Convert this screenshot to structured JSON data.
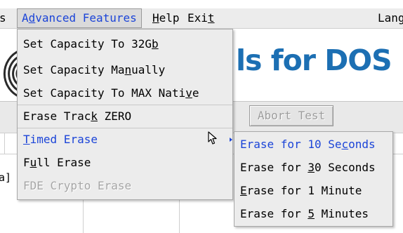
{
  "menubar": {
    "items": [
      {
        "label": "s",
        "mnemonic": ""
      },
      {
        "label": "Advanced Features",
        "pre": "A",
        "mn": "d",
        "post": "vanced Features"
      },
      {
        "label": "Help",
        "pre": "",
        "mn": "H",
        "post": "elp"
      },
      {
        "label": "Exit",
        "pre": "Exi",
        "mn": "t",
        "post": ""
      },
      {
        "label": "Lang"
      }
    ]
  },
  "brand": {
    "title": "ls for DOS"
  },
  "toolbar": {
    "abort_label": "Abort Test"
  },
  "panel": {
    "left_text": "a]"
  },
  "dropdown": {
    "items": [
      {
        "pre": "Set Capacity To 32G",
        "mn": "b",
        "post": "",
        "state": "normal"
      },
      {
        "pre": "Set Capacity Ma",
        "mn": "n",
        "post": "ually",
        "state": "normal"
      },
      {
        "pre": "Set Capacity To MAX Nati",
        "mn": "v",
        "post": "e",
        "state": "normal"
      },
      {
        "pre": "Erase Trac",
        "mn": "k",
        "post": " ZERO",
        "state": "normal"
      },
      {
        "pre": "",
        "mn": "T",
        "post": "imed Erase",
        "state": "active"
      },
      {
        "pre": "F",
        "mn": "u",
        "post": "ll Erase",
        "state": "normal"
      },
      {
        "pre": "FDE Crypto Erase",
        "mn": "",
        "post": "",
        "state": "disabled"
      }
    ]
  },
  "submenu": {
    "items": [
      {
        "pre": "Erase for 10 Se",
        "mn": "c",
        "post": "onds",
        "state": "active"
      },
      {
        "pre": "Erase for ",
        "mn": "3",
        "post": "0 Seconds",
        "state": "normal"
      },
      {
        "pre": "",
        "mn": "E",
        "post": "rase for 1 Minute",
        "state": "normal"
      },
      {
        "pre": "Erase for ",
        "mn": "5",
        "post": " Minutes",
        "state": "normal"
      }
    ]
  },
  "colors": {
    "accent": "#1b44d8",
    "brand": "#1c6fb3",
    "menu_bg": "#ececec"
  },
  "icons": {
    "submenu_indicator": "triangle-right-icon",
    "mouse_cursor": "arrow-cursor-icon",
    "logo": "logo-arcs-icon"
  }
}
